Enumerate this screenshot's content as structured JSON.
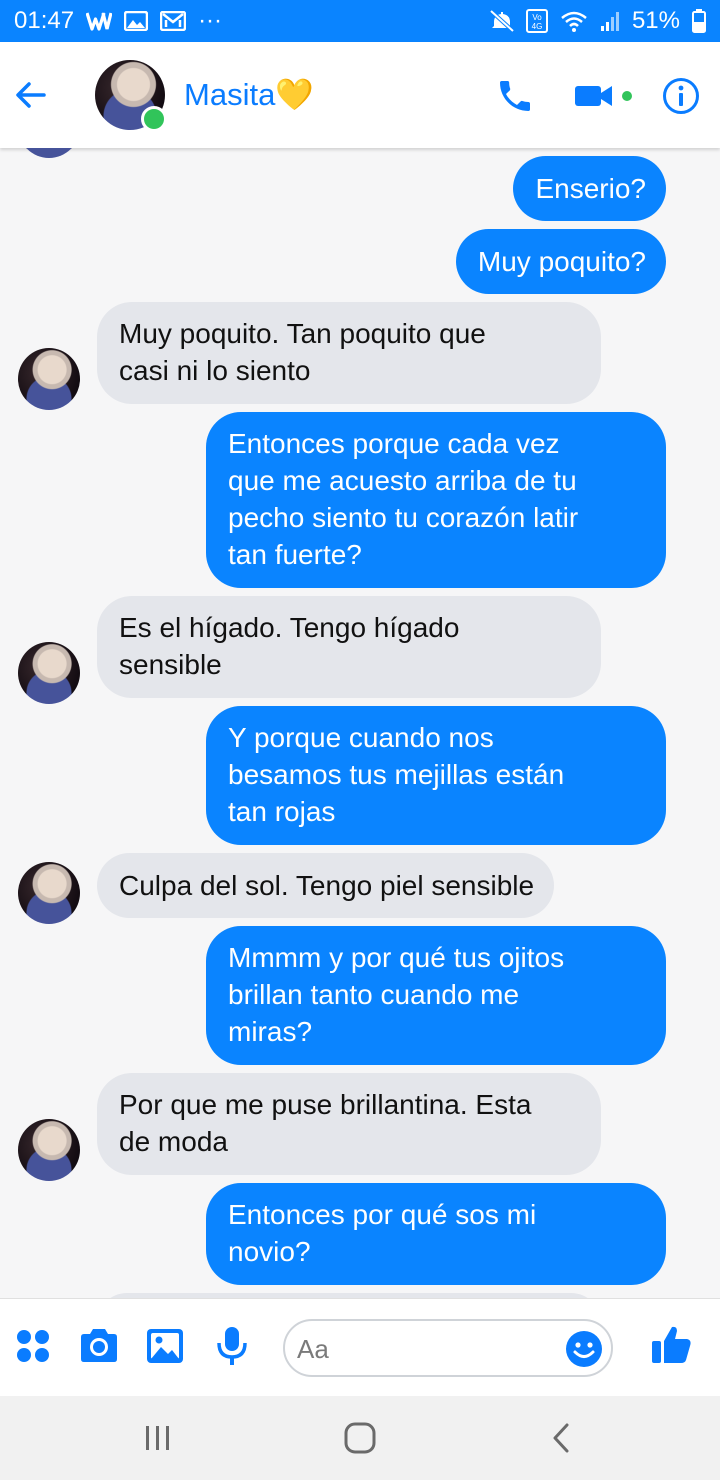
{
  "status_bar": {
    "time": "01:47",
    "dots": "···",
    "battery": "51%",
    "app_icons": [
      "w-app-icon",
      "image-icon",
      "mail-icon"
    ],
    "right_icons": [
      "mute-icon",
      "volte-icon",
      "wifi-icon",
      "signal-icon",
      "battery-icon"
    ]
  },
  "header": {
    "contact_name": "Masita💛",
    "online": true,
    "accent_color": "#0a84ff",
    "icons": [
      "back-arrow-icon",
      "phone-icon",
      "video-camera-icon",
      "info-icon"
    ]
  },
  "messages": [
    {
      "from": "me",
      "text": "Enserio?"
    },
    {
      "from": "me",
      "text": "Muy poquito?"
    },
    {
      "from": "them",
      "text": "Muy poquito. Tan poquito que\ncasi ni lo siento"
    },
    {
      "from": "me",
      "text": "Entonces porque cada vez\nque me acuesto arriba de tu\npecho siento tu corazón latir\ntan fuerte?"
    },
    {
      "from": "them",
      "text": "Es el hígado. Tengo hígado\nsensible"
    },
    {
      "from": "me",
      "text": "Y porque cuando nos\nbesamos tus mejillas están\ntan rojas"
    },
    {
      "from": "them",
      "text": "Culpa del sol. Tengo piel sensible"
    },
    {
      "from": "me",
      "text": "Mmmm y por qué tus ojitos\nbrillan tanto cuando me\nmiras?"
    },
    {
      "from": "them",
      "text": "Por que me puse brillantina. Esta\nde moda"
    },
    {
      "from": "me",
      "text": "Entonces por qué sos mi\nnovio?"
    }
  ],
  "composer": {
    "placeholder": "Aa",
    "icons": [
      "apps-grid-icon",
      "camera-icon",
      "gallery-icon",
      "microphone-icon",
      "emoji-icon",
      "thumbs-up-icon"
    ]
  },
  "nav_bar": {
    "icons": [
      "recent-apps-icon",
      "home-icon",
      "back-icon"
    ]
  }
}
